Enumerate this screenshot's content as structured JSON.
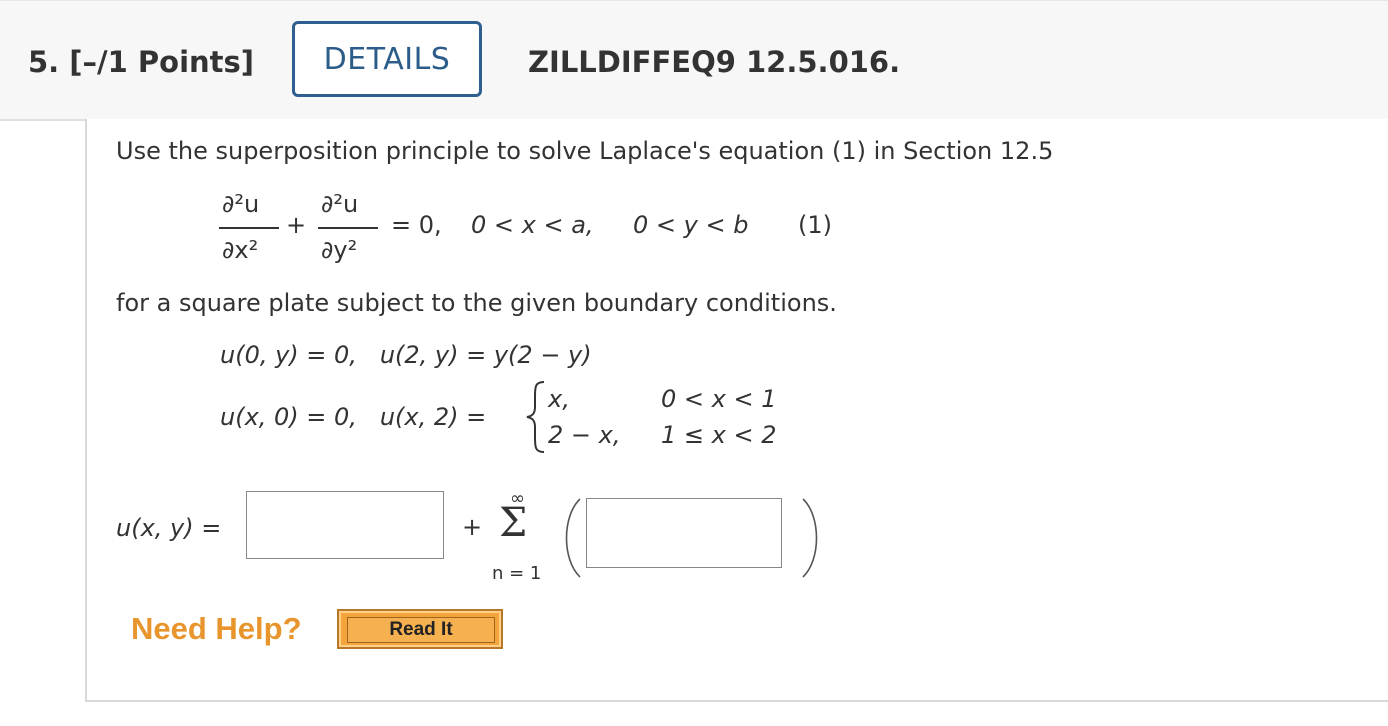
{
  "header": {
    "question_number": "5. [–/1 Points]",
    "details_button": "DETAILS",
    "question_code": "ZILLDIFFEQ9 12.5.016."
  },
  "problem": {
    "intro": "Use the superposition principle to solve Laplace's equation (1) in Section 12.5",
    "laplace": {
      "num1": "∂²u",
      "den1": "∂x²",
      "plus": "+",
      "num2": "∂²u",
      "den2": "∂y²",
      "rhs": "= 0,",
      "cond_x": "0 < x < a,",
      "cond_y": "0 < y < b",
      "eq_label": "(1)"
    },
    "square_plate_text": "for a square plate subject to the given boundary conditions.",
    "bc_line1": "u(0, y) = 0,   u(2, y) = y(2 − y)",
    "bc_line2_left": "u(x, 0) = 0,   u(x, 2) =",
    "piecewise": [
      {
        "expr": "x,",
        "cond": "0 < x < 1"
      },
      {
        "expr": "2 − x,",
        "cond": "1 ≤ x < 2"
      }
    ]
  },
  "answer": {
    "lhs": "u(x, y) =",
    "plus": "+",
    "sum_upper": "∞",
    "sum_symbol": "Σ",
    "sum_lower": "n = 1",
    "box1_value": "",
    "box2_value": ""
  },
  "help": {
    "label": "Need Help?",
    "read_it_button": "Read It"
  },
  "colors": {
    "details_border": "#2f5f8f",
    "help_orange": "#e8952d",
    "read_it_bg": "#f3a53c"
  }
}
